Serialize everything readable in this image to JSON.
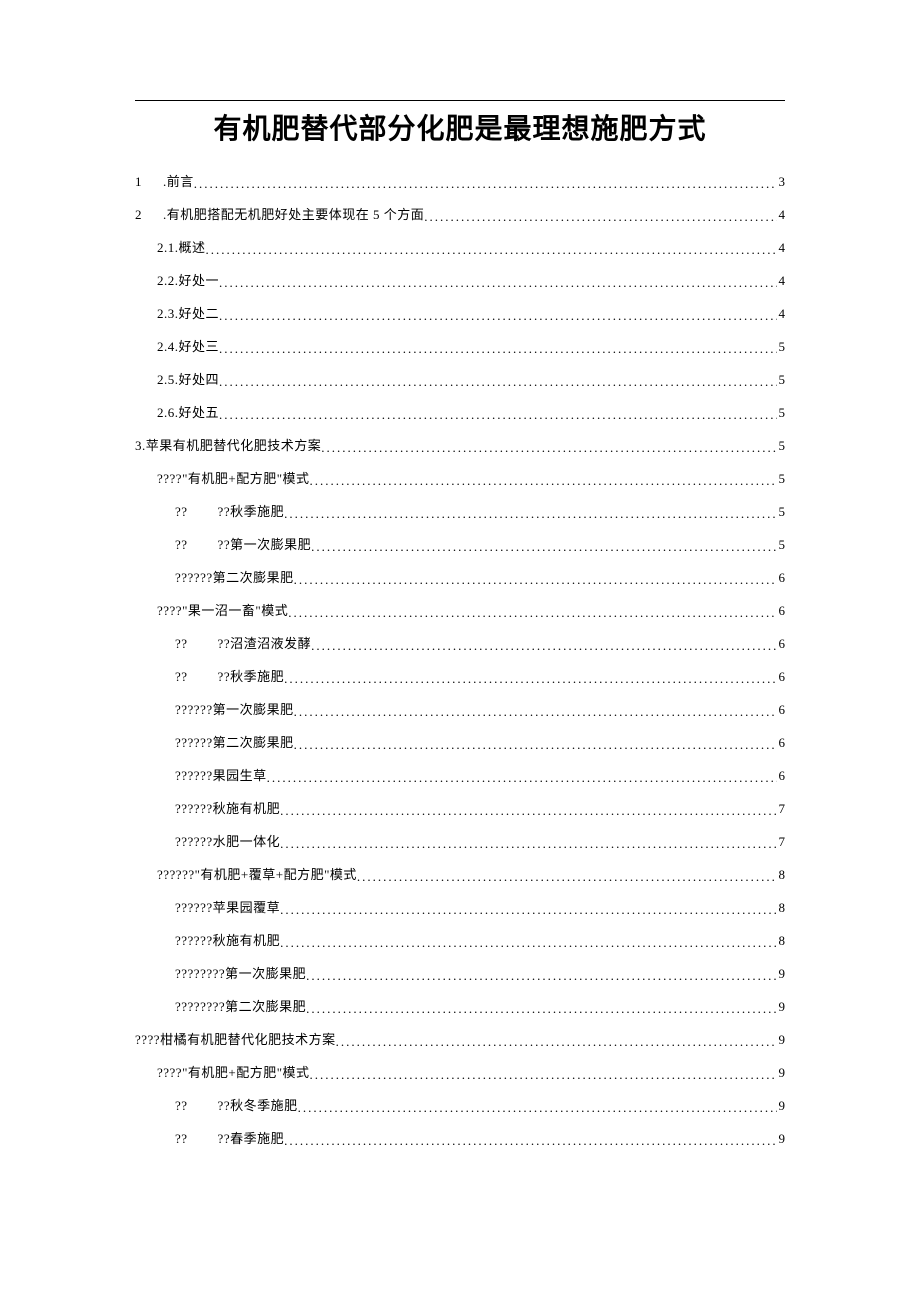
{
  "title": "有机肥替代部分化肥是最理想施肥方式",
  "toc": [
    {
      "indent": 0,
      "label_html": "<span class='toc-num'>1</span>.前言",
      "page": "3"
    },
    {
      "indent": 0,
      "label_html": "<span class='toc-num'>2</span>.有机肥搭配无机肥好处主要体现在 5 个方面 ",
      "page": "4"
    },
    {
      "indent": 1,
      "label": "2.1.概述 ",
      "page": "4"
    },
    {
      "indent": 1,
      "label": "2.2.好处一 ",
      "page": "4"
    },
    {
      "indent": 1,
      "label": "2.3.好处二 ",
      "page": "4"
    },
    {
      "indent": 1,
      "label": "2.4.好处三 ",
      "page": "5"
    },
    {
      "indent": 1,
      "label": "2.5.好处四 ",
      "page": "5"
    },
    {
      "indent": 1,
      "label": "2.6.好处五 ",
      "page": "5"
    },
    {
      "indent": 0,
      "label": "3.苹果有机肥替代化肥技术方案 ",
      "page": "5"
    },
    {
      "indent": 1,
      "label": "????\"有机肥+配方肥\"模式 ",
      "page": "5"
    },
    {
      "indent": 2,
      "qq": true,
      "p1": "??",
      "p2": "??秋季施肥",
      "page": "5"
    },
    {
      "indent": 2,
      "qq": true,
      "p1": "??",
      "p2": "??第一次膨果肥",
      "page": "5"
    },
    {
      "indent": 2,
      "label": "??????第二次膨果肥 ",
      "page": "6"
    },
    {
      "indent": 1,
      "label": "????\"果一沼一畜\"模式 ",
      "page": "6"
    },
    {
      "indent": 2,
      "qq": true,
      "p1": "??",
      "p2": "??沼渣沼液发酵",
      "page": "6"
    },
    {
      "indent": 2,
      "qq": true,
      "p1": "??",
      "p2": "??秋季施肥",
      "page": "6"
    },
    {
      "indent": 2,
      "label": "??????第一次膨果肥 ",
      "page": "6"
    },
    {
      "indent": 2,
      "label": "??????第二次膨果肥 ",
      "page": "6"
    },
    {
      "indent": 2,
      "label": "??????果园生草 ",
      "page": "6"
    },
    {
      "indent": 2,
      "label": "??????秋施有机肥 ",
      "page": "7"
    },
    {
      "indent": 2,
      "label": "??????水肥一体化 ",
      "page": "7"
    },
    {
      "indent": 1,
      "label": "??????\"有机肥+覆草+配方肥\"模式 ",
      "page": "8"
    },
    {
      "indent": 2,
      "label": "??????苹果园覆草 ",
      "page": "8"
    },
    {
      "indent": 2,
      "label": "??????秋施有机肥 ",
      "page": "8"
    },
    {
      "indent": 2,
      "label": "????????第一次膨果肥 ",
      "page": "9"
    },
    {
      "indent": 2,
      "label": "????????第二次膨果肥 ",
      "page": "9"
    },
    {
      "indent": 0,
      "label": "????柑橘有机肥替代化肥技术方案",
      "page": "9"
    },
    {
      "indent": 1,
      "label": "????\"有机肥+配方肥\"模式 ",
      "page": "9"
    },
    {
      "indent": 2,
      "qq": true,
      "p1": "??",
      "p2": "??秋冬季施肥",
      "page": "9"
    },
    {
      "indent": 2,
      "qq": true,
      "p1": "??",
      "p2": "??春季施肥",
      "page": "9"
    }
  ]
}
